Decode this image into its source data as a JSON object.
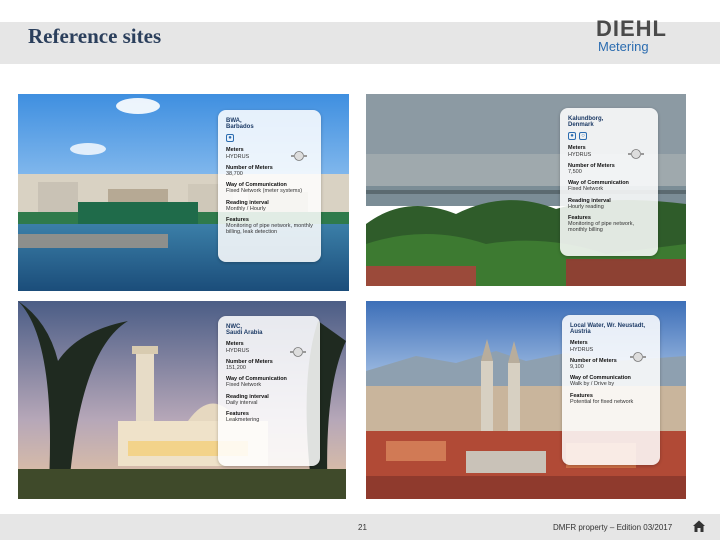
{
  "slide": {
    "title": "Reference sites",
    "logo": {
      "brand": "DIEHL",
      "sub": "Metering"
    }
  },
  "cards": [
    {
      "name": "card-barbados",
      "title": "BWA,\nBarbados",
      "fields": [
        {
          "key": "Meters",
          "value": "HYDRUS"
        },
        {
          "key": "Number of Meters",
          "value": "38,700"
        },
        {
          "key": "Way of Communication",
          "value": "Fixed Network (meter systems)"
        },
        {
          "key": "Reading interval",
          "value": "Monthly / Hourly"
        },
        {
          "key": "Features",
          "value": "Monitoring of pipe network, monthly billing, leak detection"
        }
      ]
    },
    {
      "name": "card-denmark",
      "title": "Kalundborg,\nDenmark",
      "fields": [
        {
          "key": "Meters",
          "value": "HYDRUS"
        },
        {
          "key": "Number of Meters",
          "value": "7,500"
        },
        {
          "key": "Way of Communication",
          "value": "Fixed Network"
        },
        {
          "key": "Reading interval",
          "value": "Hourly reading"
        },
        {
          "key": "Features",
          "value": "Monitoring of pipe network, monthly billing"
        }
      ]
    },
    {
      "name": "card-saudi",
      "title": "NWC,\nSaudi Arabia",
      "fields": [
        {
          "key": "Meters",
          "value": "HYDRUS"
        },
        {
          "key": "Number of Meters",
          "value": "151,200"
        },
        {
          "key": "Way of Communication",
          "value": "Fixed Network"
        },
        {
          "key": "Reading interval",
          "value": "Daily interval"
        },
        {
          "key": "Features",
          "value": "Leakmetering"
        }
      ]
    },
    {
      "name": "card-austria",
      "title": "Local Water, Wr. Neustadt,\nAustria",
      "fields": [
        {
          "key": "Meters",
          "value": "HYDRUS"
        },
        {
          "key": "Number of Meters",
          "value": "9,100"
        },
        {
          "key": "Way of Communication",
          "value": "Walk by / Drive by"
        },
        {
          "key": "Features",
          "value": "Potential for fixed network"
        }
      ]
    }
  ],
  "footer": {
    "page_number": "21",
    "text": "DMFR property – Edition 03/2017"
  },
  "colors": {
    "title": "#2b3f5c",
    "logo_blue": "#2b6cb0",
    "band": "#e6e6e6"
  },
  "icons": [
    "home-icon",
    "water-drop-icon",
    "meter-icon"
  ]
}
